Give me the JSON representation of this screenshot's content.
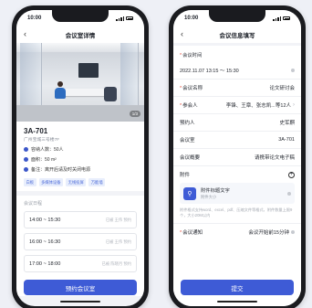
{
  "left": {
    "time": "10:00",
    "nav_title": "会议室详情",
    "image_badge": "1/3",
    "room_name": "3A-701",
    "room_location": "广州宝城三号楼7F",
    "attributes": [
      {
        "label": "容纳人数：50人"
      },
      {
        "label": "面积：50 m²"
      },
      {
        "label": "备注：离开后请及时关闭电源"
      }
    ],
    "tags": [
      "白板",
      "多媒体设备",
      "无线投屏",
      "万能墙"
    ],
    "schedule_title": "会议日程",
    "slots": [
      {
        "time": "14:00 ~ 15:30",
        "who": "已被 王伟 预约"
      },
      {
        "time": "16:00 ~ 16:30",
        "who": "已被 王伟 预约"
      },
      {
        "time": "17:00 ~ 18:00",
        "who": "已被 陈晓月 预约"
      }
    ],
    "book_button": "预约会议室"
  },
  "right": {
    "time": "10:00",
    "nav_title": "会议信息填写",
    "meeting_time_label": "会议时间",
    "meeting_time_value": "2022.11.07  13:15 ～ 15:30",
    "name_label": "会议名称",
    "name_value": "论文研讨会",
    "participants_label": "参会人",
    "participants_value": "李锋、王章、张志凯...等12人",
    "booker_label": "预约人",
    "booker_value": "史军麒",
    "room_label": "会议室",
    "room_value": "3A-701",
    "summary_label": "会议概要",
    "summary_value": "请携带论文电子稿",
    "attachment_label": "附件",
    "attachment_title": "附件标题文字",
    "attachment_size": "附件大小",
    "attachment_hint": "附件格式支持word、excel、pdf、压缩文件等格式，附件数量上限9个，大小20M以内",
    "notify_label": "会议通知",
    "notify_value": "会议开始前15分钟",
    "submit_button": "提交"
  },
  "colors": {
    "accent": "#3e5bd6",
    "required": "#e34a3a"
  }
}
